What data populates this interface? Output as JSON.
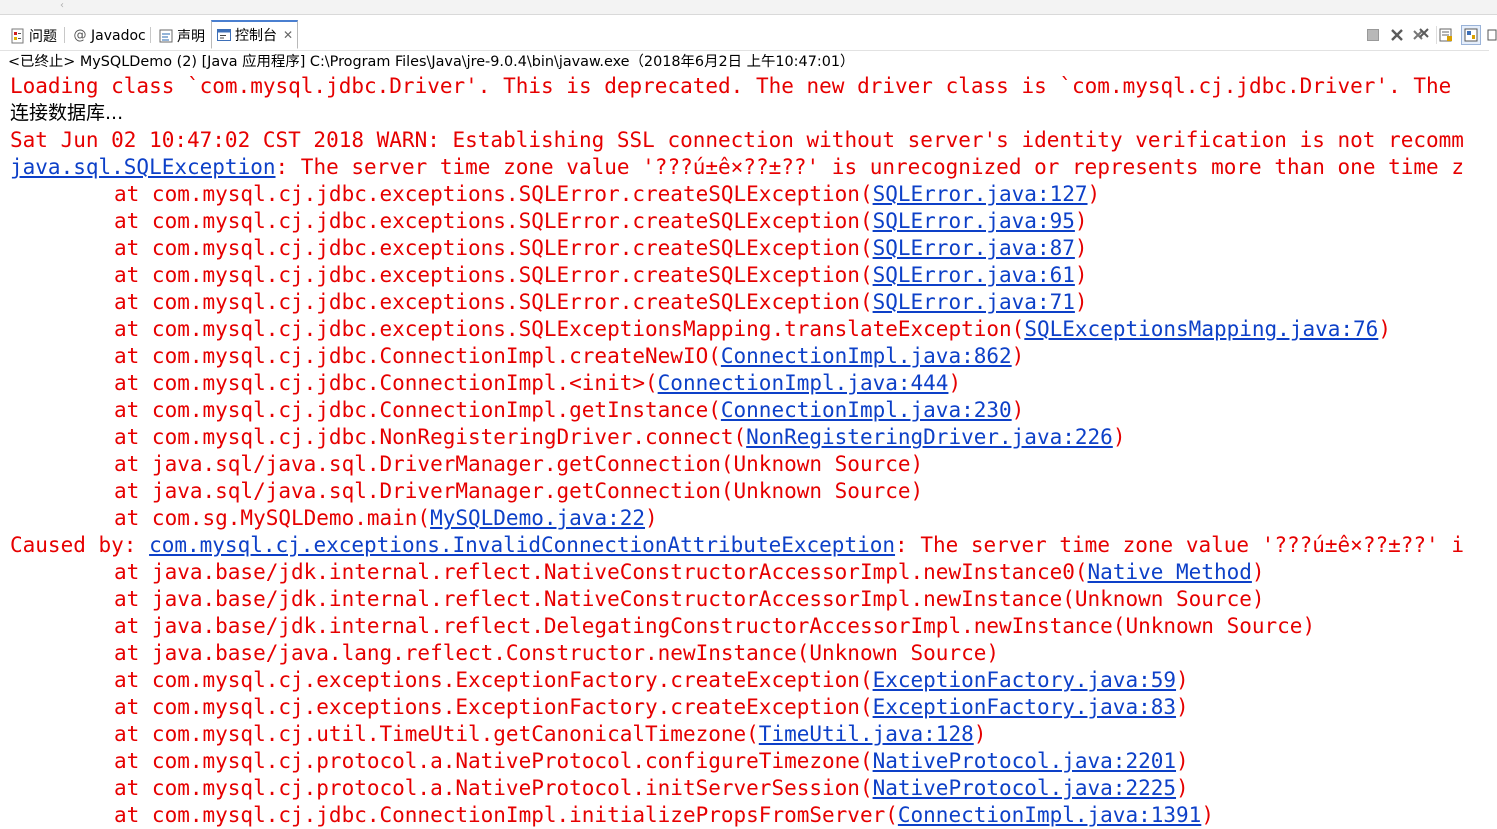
{
  "colors": {
    "error": "#e60000",
    "link": "#0d40c8",
    "accent": "#4a7fd0"
  },
  "tabs": [
    {
      "label": "问题",
      "icon": "problems-icon"
    },
    {
      "label": "Javadoc",
      "icon": "javadoc-at-icon"
    },
    {
      "label": "声明",
      "icon": "declaration-icon"
    },
    {
      "label": "控制台",
      "icon": "console-icon",
      "active": true,
      "close": "✕"
    }
  ],
  "status": "<已终止> MySQLDemo (2) [Java 应用程序] C:\\Program Files\\Java\\jre-9.0.4\\bin\\javaw.exe（2018年6月2日 上午10:47:01）",
  "console": {
    "lines": [
      {
        "parts": [
          {
            "t": "Loading class `com.mysql.jdbc.Driver'. This is deprecated. The new driver class is `com.mysql.cj.jdbc.Driver'. The"
          }
        ]
      },
      {
        "black": true,
        "parts": [
          {
            "t": "连接数据库..."
          }
        ]
      },
      {
        "parts": [
          {
            "t": "Sat Jun 02 10:47:02 CST 2018 WARN: Establishing SSL connection without server's identity verification is not recomm"
          }
        ]
      },
      {
        "parts": [
          {
            "t": "java.sql.SQLException",
            "link": true
          },
          {
            "t": ": The server time zone value '???ú±ê×??±??' is unrecognized or represents more than one time z"
          }
        ]
      },
      {
        "indent": true,
        "parts": [
          {
            "t": "at com.mysql.cj.jdbc.exceptions.SQLError.createSQLException("
          },
          {
            "t": "SQLError.java:127",
            "link": true
          },
          {
            "t": ")"
          }
        ]
      },
      {
        "indent": true,
        "parts": [
          {
            "t": "at com.mysql.cj.jdbc.exceptions.SQLError.createSQLException("
          },
          {
            "t": "SQLError.java:95",
            "link": true
          },
          {
            "t": ")"
          }
        ]
      },
      {
        "indent": true,
        "parts": [
          {
            "t": "at com.mysql.cj.jdbc.exceptions.SQLError.createSQLException("
          },
          {
            "t": "SQLError.java:87",
            "link": true
          },
          {
            "t": ")"
          }
        ]
      },
      {
        "indent": true,
        "parts": [
          {
            "t": "at com.mysql.cj.jdbc.exceptions.SQLError.createSQLException("
          },
          {
            "t": "SQLError.java:61",
            "link": true
          },
          {
            "t": ")"
          }
        ]
      },
      {
        "indent": true,
        "parts": [
          {
            "t": "at com.mysql.cj.jdbc.exceptions.SQLError.createSQLException("
          },
          {
            "t": "SQLError.java:71",
            "link": true
          },
          {
            "t": ")"
          }
        ]
      },
      {
        "indent": true,
        "parts": [
          {
            "t": "at com.mysql.cj.jdbc.exceptions.SQLExceptionsMapping.translateException("
          },
          {
            "t": "SQLExceptionsMapping.java:76",
            "link": true
          },
          {
            "t": ")"
          }
        ]
      },
      {
        "indent": true,
        "parts": [
          {
            "t": "at com.mysql.cj.jdbc.ConnectionImpl.createNewIO("
          },
          {
            "t": "ConnectionImpl.java:862",
            "link": true
          },
          {
            "t": ")"
          }
        ]
      },
      {
        "indent": true,
        "parts": [
          {
            "t": "at com.mysql.cj.jdbc.ConnectionImpl.<init>("
          },
          {
            "t": "ConnectionImpl.java:444",
            "link": true
          },
          {
            "t": ")"
          }
        ]
      },
      {
        "indent": true,
        "parts": [
          {
            "t": "at com.mysql.cj.jdbc.ConnectionImpl.getInstance("
          },
          {
            "t": "ConnectionImpl.java:230",
            "link": true
          },
          {
            "t": ")"
          }
        ]
      },
      {
        "indent": true,
        "parts": [
          {
            "t": "at com.mysql.cj.jdbc.NonRegisteringDriver.connect("
          },
          {
            "t": "NonRegisteringDriver.java:226",
            "link": true
          },
          {
            "t": ")"
          }
        ]
      },
      {
        "indent": true,
        "parts": [
          {
            "t": "at java.sql/java.sql.DriverManager.getConnection(Unknown Source)"
          }
        ]
      },
      {
        "indent": true,
        "parts": [
          {
            "t": "at java.sql/java.sql.DriverManager.getConnection(Unknown Source)"
          }
        ]
      },
      {
        "indent": true,
        "parts": [
          {
            "t": "at com.sg.MySQLDemo.main("
          },
          {
            "t": "MySQLDemo.java:22",
            "link": true
          },
          {
            "t": ")"
          }
        ]
      },
      {
        "parts": [
          {
            "t": "Caused by: "
          },
          {
            "t": "com.mysql.cj.exceptions.InvalidConnectionAttributeException",
            "link": true
          },
          {
            "t": ": The server time zone value '???ú±ê×??±??' i"
          }
        ]
      },
      {
        "indent": true,
        "parts": [
          {
            "t": "at java.base/jdk.internal.reflect.NativeConstructorAccessorImpl.newInstance0("
          },
          {
            "t": "Native Method",
            "link": true
          },
          {
            "t": ")"
          }
        ]
      },
      {
        "indent": true,
        "parts": [
          {
            "t": "at java.base/jdk.internal.reflect.NativeConstructorAccessorImpl.newInstance(Unknown Source)"
          }
        ]
      },
      {
        "indent": true,
        "parts": [
          {
            "t": "at java.base/jdk.internal.reflect.DelegatingConstructorAccessorImpl.newInstance(Unknown Source)"
          }
        ]
      },
      {
        "indent": true,
        "parts": [
          {
            "t": "at java.base/java.lang.reflect.Constructor.newInstance(Unknown Source)"
          }
        ]
      },
      {
        "indent": true,
        "parts": [
          {
            "t": "at com.mysql.cj.exceptions.ExceptionFactory.createException("
          },
          {
            "t": "ExceptionFactory.java:59",
            "link": true
          },
          {
            "t": ")"
          }
        ]
      },
      {
        "indent": true,
        "parts": [
          {
            "t": "at com.mysql.cj.exceptions.ExceptionFactory.createException("
          },
          {
            "t": "ExceptionFactory.java:83",
            "link": true
          },
          {
            "t": ")"
          }
        ]
      },
      {
        "indent": true,
        "parts": [
          {
            "t": "at com.mysql.cj.util.TimeUtil.getCanonicalTimezone("
          },
          {
            "t": "TimeUtil.java:128",
            "link": true
          },
          {
            "t": ")"
          }
        ]
      },
      {
        "indent": true,
        "parts": [
          {
            "t": "at com.mysql.cj.protocol.a.NativeProtocol.configureTimezone("
          },
          {
            "t": "NativeProtocol.java:2201",
            "link": true
          },
          {
            "t": ")"
          }
        ]
      },
      {
        "indent": true,
        "parts": [
          {
            "t": "at com.mysql.cj.protocol.a.NativeProtocol.initServerSession("
          },
          {
            "t": "NativeProtocol.java:2225",
            "link": true
          },
          {
            "t": ")"
          }
        ]
      },
      {
        "indent": true,
        "parts": [
          {
            "t": "at com.mysql.cj.jdbc.ConnectionImpl.initializePropsFromServer("
          },
          {
            "t": "ConnectionImpl.java:1391",
            "link": true
          },
          {
            "t": ")"
          }
        ]
      }
    ]
  }
}
